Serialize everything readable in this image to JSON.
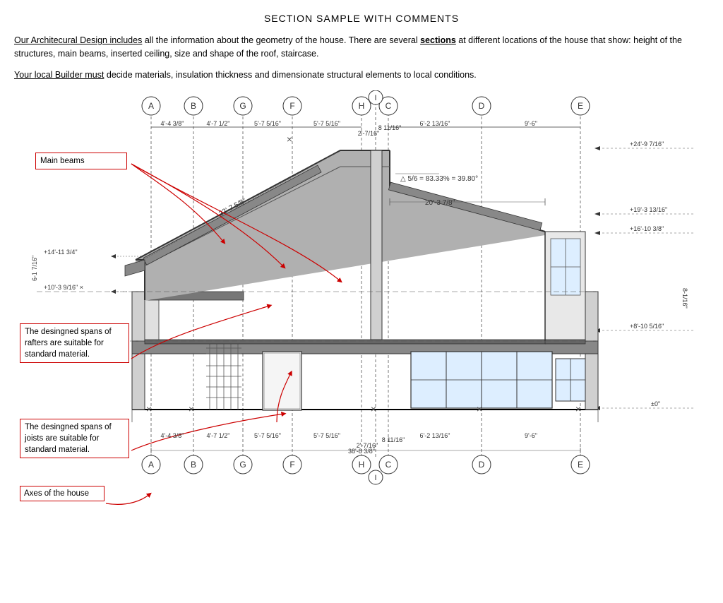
{
  "title": "SECTION SAMPLE WITH COMMENTS",
  "intro1": "Our Architecural Design includes all the information about the geometry of the house. There are several sections at different locations of the house that show: height of the structures, main beams, inserted ceiling, size and shape of the roof, staircase.",
  "intro2": "Your local Builder must decide materials, insulation thickness and dimensionate structural elements to local conditions.",
  "comments": {
    "main_beams": "Main beams",
    "rafters": "The desingned spans of rafters are suitable for standard material.",
    "joists": "The desingned spans of joists are suitable for standard material.",
    "axes": "Axes of the house"
  },
  "axes_top": [
    "A",
    "B",
    "G",
    "F",
    "H",
    "C",
    "I",
    "D",
    "E"
  ],
  "dims_top": [
    "4'-4 3/8\"",
    "4'-7 1/2\"",
    "5'-7 5/16\"",
    "5'-7 5/16\"",
    "2'-7/16\"",
    "8 11/16\"",
    "6'-2 13/16\"",
    "9'-6\""
  ],
  "dims_right": [
    "+24'-9 7/16\"",
    "+19'-3 13/16\"",
    "+16'-10 3/8\"",
    "+8'-10 5/16\"",
    "±0\""
  ],
  "dims_left": [
    "+14'-11 3/4\"",
    "+10'-3 9/16\"",
    "6-1 7/16\"",
    "8-1/16\""
  ],
  "roof_slope": "5/6 = 83.33% = 39.80°",
  "roof_width": "20'-3 7/8\"",
  "rafter_len": "22'-7 5/8\"",
  "dims_bottom": [
    "4'-4 3/8\"",
    "4'-7 1/2\"",
    "5'-7 5/16\"",
    "5'-7 5/16\"",
    "2'-7/16\"",
    "8 11/16\"",
    "6'-2 13/16\"",
    "9'-6\"",
    "38'-8 3/8\""
  ]
}
